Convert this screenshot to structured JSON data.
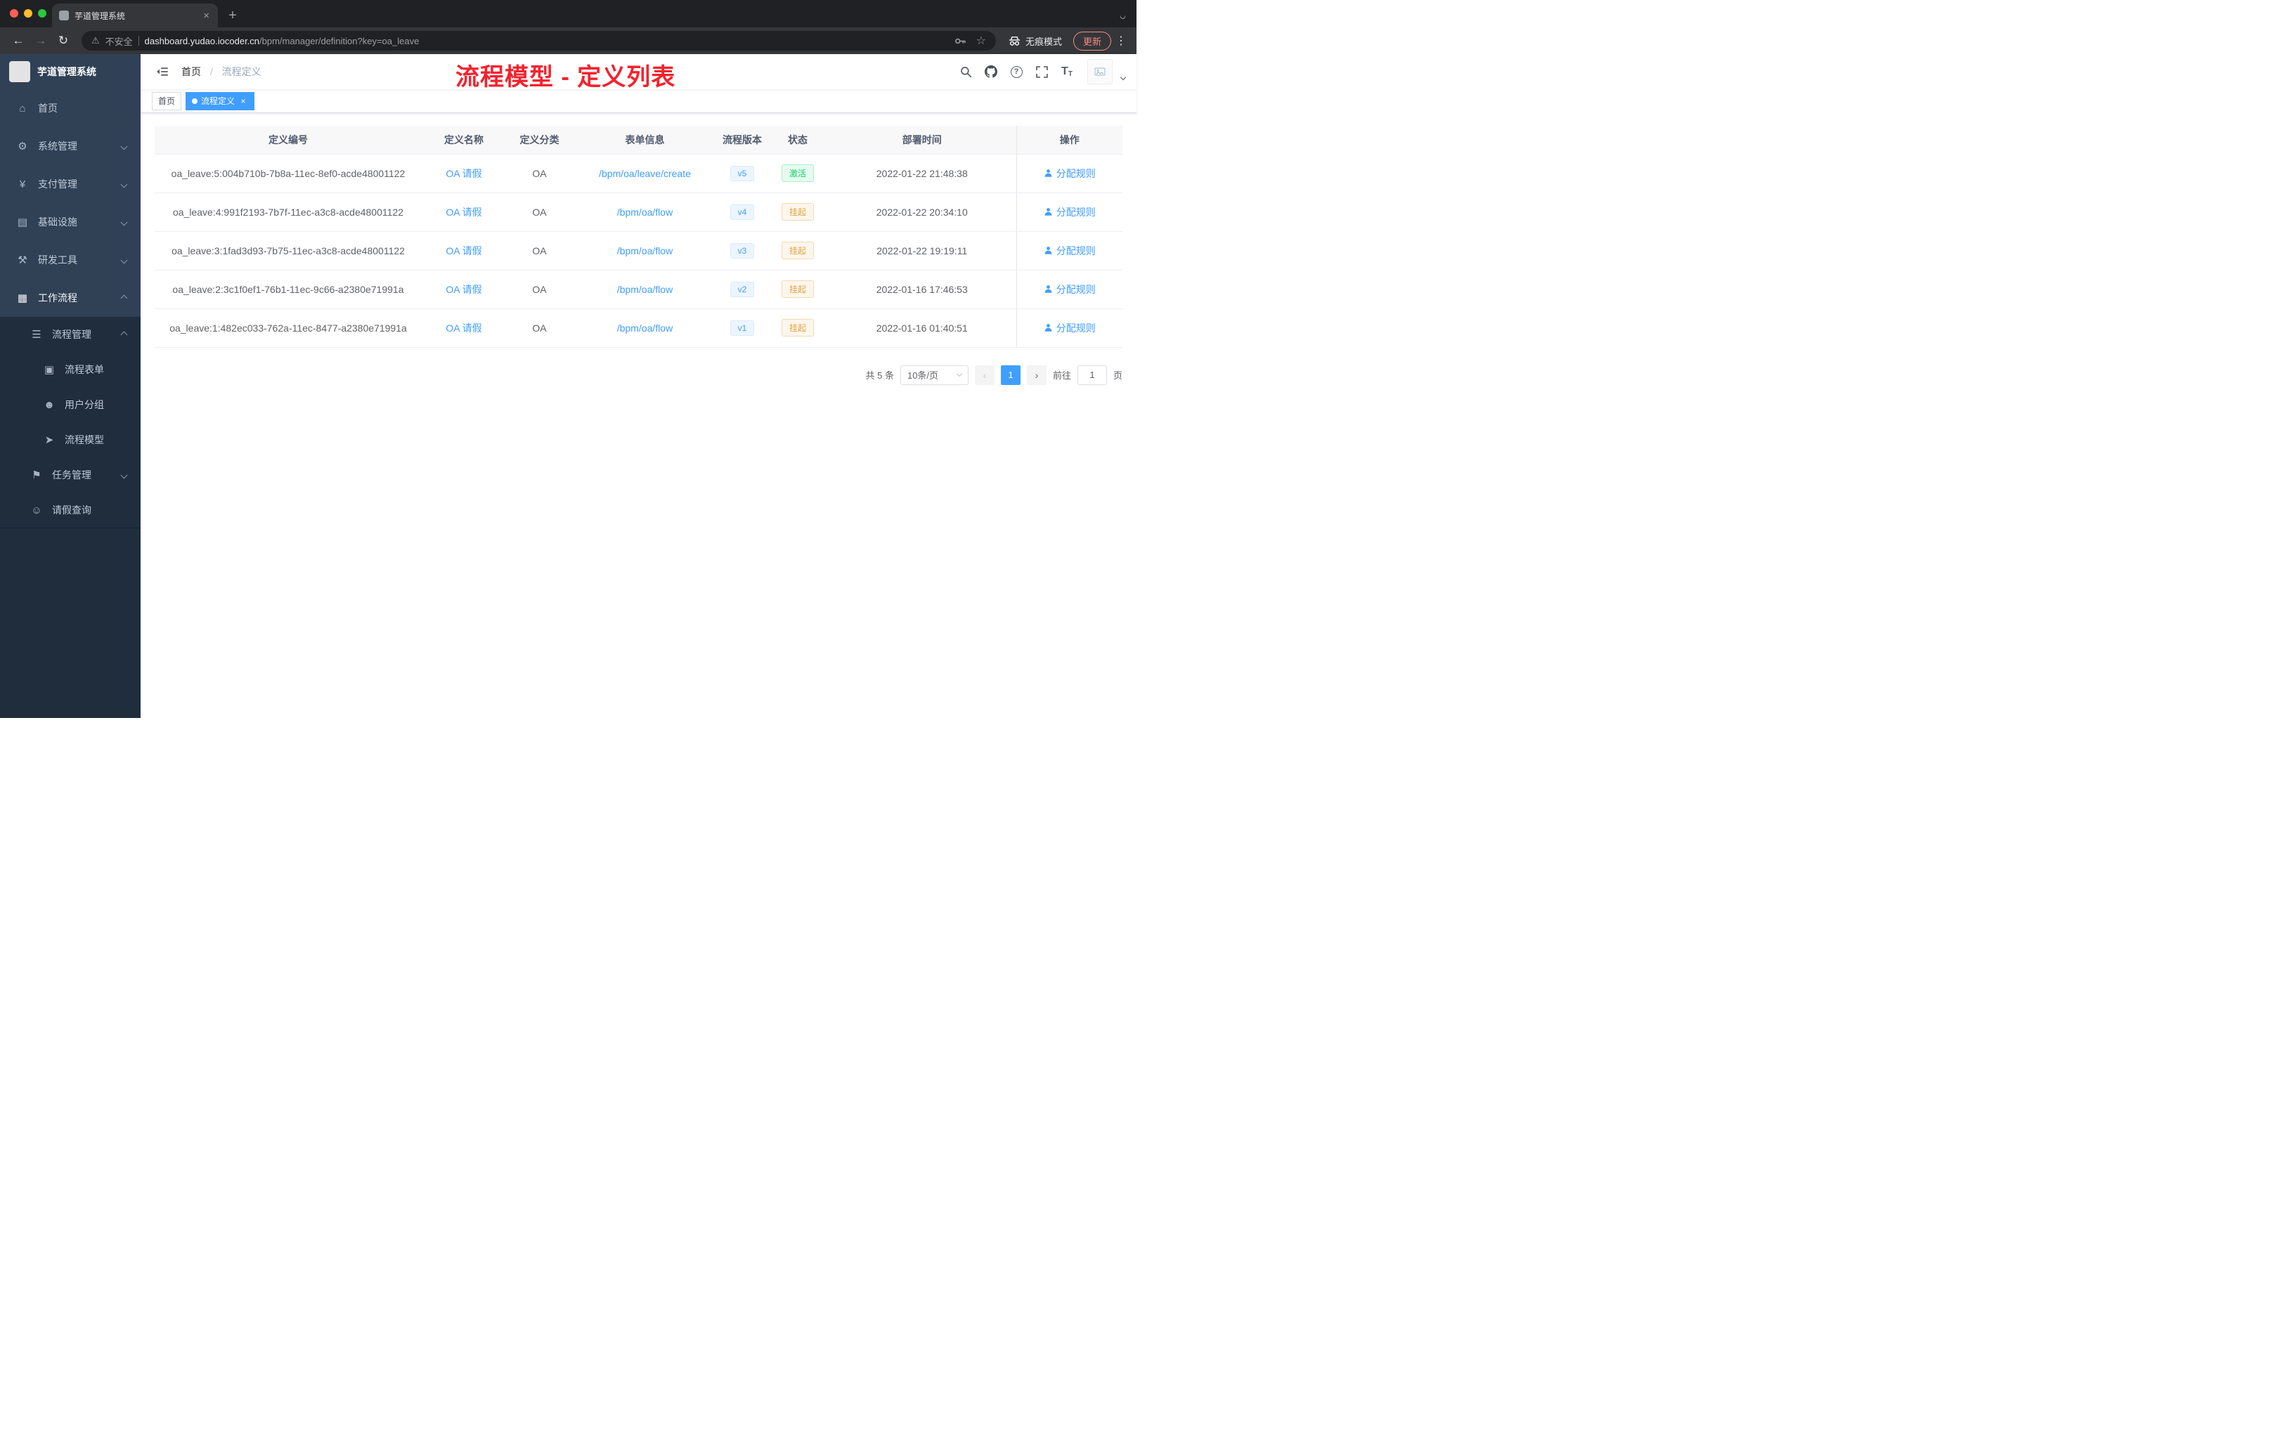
{
  "browser": {
    "tab": {
      "title": "芋道管理系统"
    },
    "toolbar": {
      "security_label": "不安全",
      "url_domain": "dashboard.yudao.iocoder.cn",
      "url_path": "/bpm/manager/definition?key=oa_leave",
      "incognito_label": "无痕模式",
      "update_label": "更新"
    }
  },
  "icons": {
    "close": "×",
    "plus": "+",
    "back": "←",
    "forward": "→",
    "reload": "↻",
    "warning": "⚠",
    "star": "☆",
    "kebab": "⋮",
    "question": "?",
    "size_big": "T",
    "size_small": "T",
    "home": "⌂",
    "system": "⚙",
    "payment": "¥",
    "infra": "▤",
    "devtools": "⚒",
    "workflow": "▦",
    "process_mgmt": "☰",
    "process_form": "▣",
    "user_group": "☻",
    "process_model": "➤",
    "task_mgmt": "⚑",
    "leave_query": "☺"
  },
  "sidebar": {
    "logo_title": "芋道管理系统",
    "items": [
      {
        "label": "首页"
      },
      {
        "label": "系统管理"
      },
      {
        "label": "支付管理"
      },
      {
        "label": "基础设施"
      },
      {
        "label": "研发工具"
      },
      {
        "label": "工作流程"
      },
      {
        "label": "流程管理"
      },
      {
        "label": "流程表单"
      },
      {
        "label": "用户分组"
      },
      {
        "label": "流程模型"
      },
      {
        "label": "任务管理"
      },
      {
        "label": "请假查询"
      }
    ]
  },
  "header": {
    "breadcrumb": {
      "home": "首页",
      "separator": "/",
      "current": "流程定义"
    },
    "annotation": "流程模型 - 定义列表"
  },
  "tags": {
    "items": [
      {
        "label": "首页"
      },
      {
        "label": "流程定义",
        "close": "×"
      }
    ]
  },
  "table": {
    "columns": [
      "定义编号",
      "定义名称",
      "定义分类",
      "表单信息",
      "流程版本",
      "状态",
      "部署时间",
      "操作"
    ],
    "rows": [
      {
        "id": "oa_leave:5:004b710b-7b8a-11ec-8ef0-acde48001122",
        "name": "OA 请假",
        "category": "OA",
        "form": "/bpm/oa/leave/create",
        "version": "v5",
        "status": "激活",
        "status_type": "success",
        "deploy_time": "2022-01-22 21:48:38",
        "action": "分配规则"
      },
      {
        "id": "oa_leave:4:991f2193-7b7f-11ec-a3c8-acde48001122",
        "name": "OA 请假",
        "category": "OA",
        "form": "/bpm/oa/flow",
        "version": "v4",
        "status": "挂起",
        "status_type": "warning",
        "deploy_time": "2022-01-22 20:34:10",
        "action": "分配规则"
      },
      {
        "id": "oa_leave:3:1fad3d93-7b75-11ec-a3c8-acde48001122",
        "name": "OA 请假",
        "category": "OA",
        "form": "/bpm/oa/flow",
        "version": "v3",
        "status": "挂起",
        "status_type": "warning",
        "deploy_time": "2022-01-22 19:19:11",
        "action": "分配规则"
      },
      {
        "id": "oa_leave:2:3c1f0ef1-76b1-11ec-9c66-a2380e71991a",
        "name": "OA 请假",
        "category": "OA",
        "form": "/bpm/oa/flow",
        "version": "v2",
        "status": "挂起",
        "status_type": "warning",
        "deploy_time": "2022-01-16 17:46:53",
        "action": "分配规则"
      },
      {
        "id": "oa_leave:1:482ec033-762a-11ec-8477-a2380e71991a",
        "name": "OA 请假",
        "category": "OA",
        "form": "/bpm/oa/flow",
        "version": "v1",
        "status": "挂起",
        "status_type": "warning",
        "deploy_time": "2022-01-16 01:40:51",
        "action": "分配规则"
      }
    ]
  },
  "pagination": {
    "total": "共 5 条",
    "page_size": "10条/页",
    "prev": "‹",
    "current_page": "1",
    "next": "›",
    "jump_prefix": "前往",
    "jump_value": "1",
    "jump_suffix": "页"
  },
  "colors": {
    "accent": "#409eff",
    "sidebar_bg": "#304156",
    "submenu_bg": "#1f2d3d",
    "success": "#13ce66",
    "warning": "#e6a23c",
    "annotation_red": "#f5222d"
  }
}
